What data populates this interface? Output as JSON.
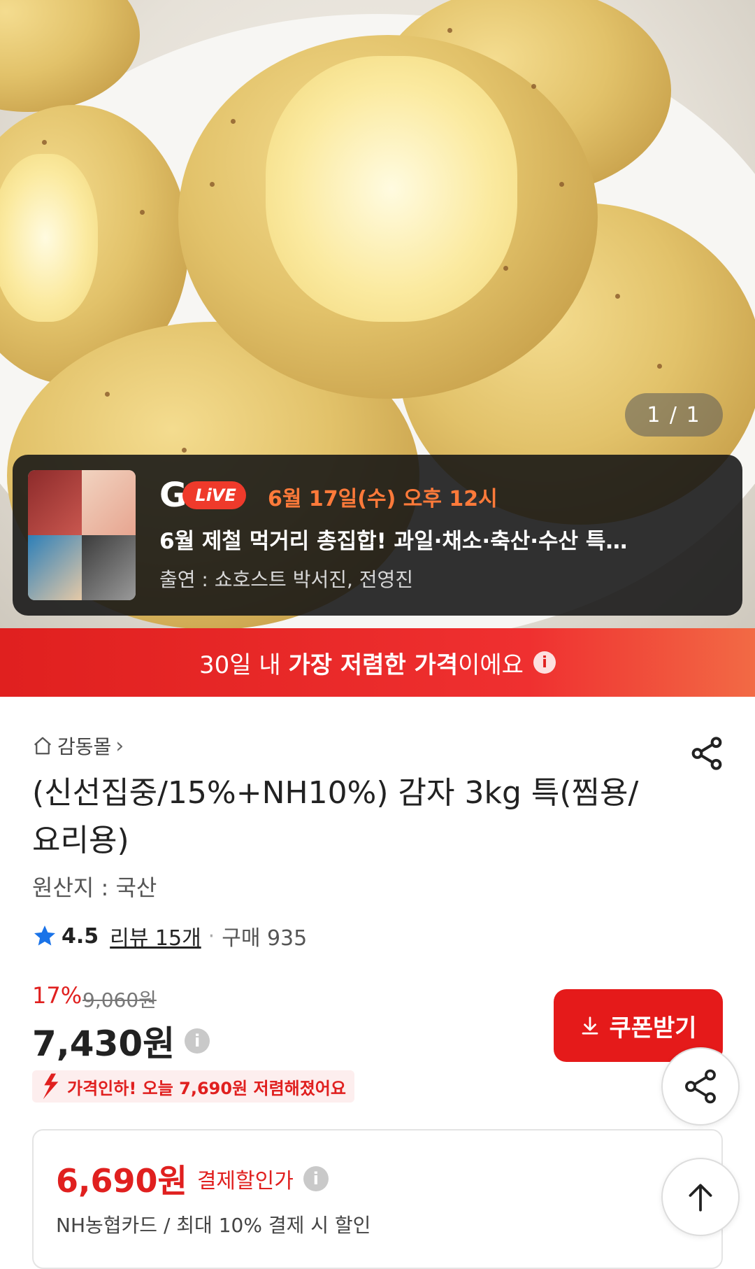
{
  "image_counter": "1 / 1",
  "live": {
    "logo_g": "G",
    "logo_live": "LiVE",
    "date": "6월 17일(수) 오후 12시",
    "title": "6월 제철 먹거리 총집합! 과일·채소·축산·수산 특…",
    "cast": "출연 : 쇼호스트 박서진, 전영진"
  },
  "banner": {
    "pre": "30일 내 ",
    "bold": "가장 저렴한 가격",
    "post": "이에요",
    "info": "i"
  },
  "breadcrumb": {
    "label": "감동몰",
    "chevron": "›"
  },
  "product": {
    "title": "(신선집중/15%+NH10%) 감자 3kg 특(찜용/요리용)",
    "origin": "원산지 : 국산"
  },
  "rating": {
    "score": "4.5",
    "reviews": "리뷰 15개",
    "sep": "·",
    "purchases": "구매 935"
  },
  "pricing": {
    "discount": "17%",
    "original": "9,060원",
    "price": "7,430원",
    "info": "i",
    "price_drop": "가격인하! 오늘 7,690원 저렴해졌어요"
  },
  "coupon": {
    "label": "쿠폰받기"
  },
  "card": {
    "price": "6,690원",
    "label": "결제할인가",
    "info": "i",
    "sub": "NH농협카드 / 최대 10% 결제 시 할인"
  },
  "colors": {
    "accent": "#e51a1a",
    "live_date": "#ff7a3a"
  }
}
